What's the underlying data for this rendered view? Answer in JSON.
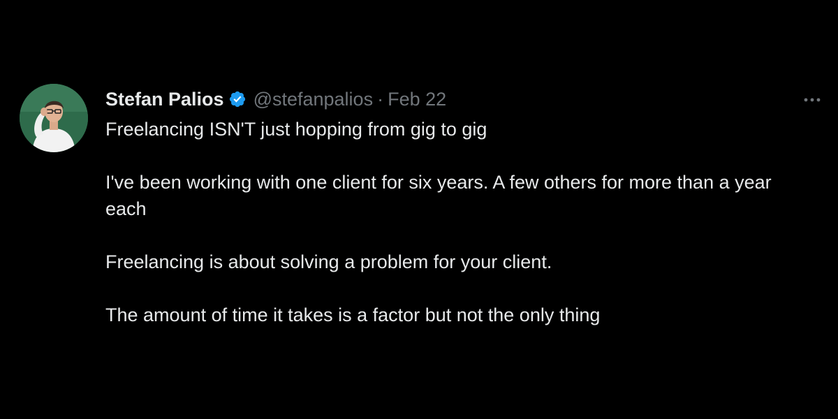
{
  "tweet": {
    "author": {
      "display_name": "Stefan Palios",
      "handle": "@stefanpalios",
      "verified": true,
      "avatar_icon": "profile-photo"
    },
    "separator": "·",
    "date": "Feb 22",
    "more_icon": "more-horizontal-icon",
    "paragraphs": [
      "Freelancing ISN'T just hopping from gig to gig",
      "I've been working with one client for six years. A few others for more than a year each",
      "Freelancing is about solving a problem for your client.",
      "The amount of time it takes is a factor but not the only thing"
    ]
  },
  "colors": {
    "background": "#000000",
    "text": "#e7e9ea",
    "muted": "#71767b",
    "verified_badge": "#1d9bf0"
  }
}
